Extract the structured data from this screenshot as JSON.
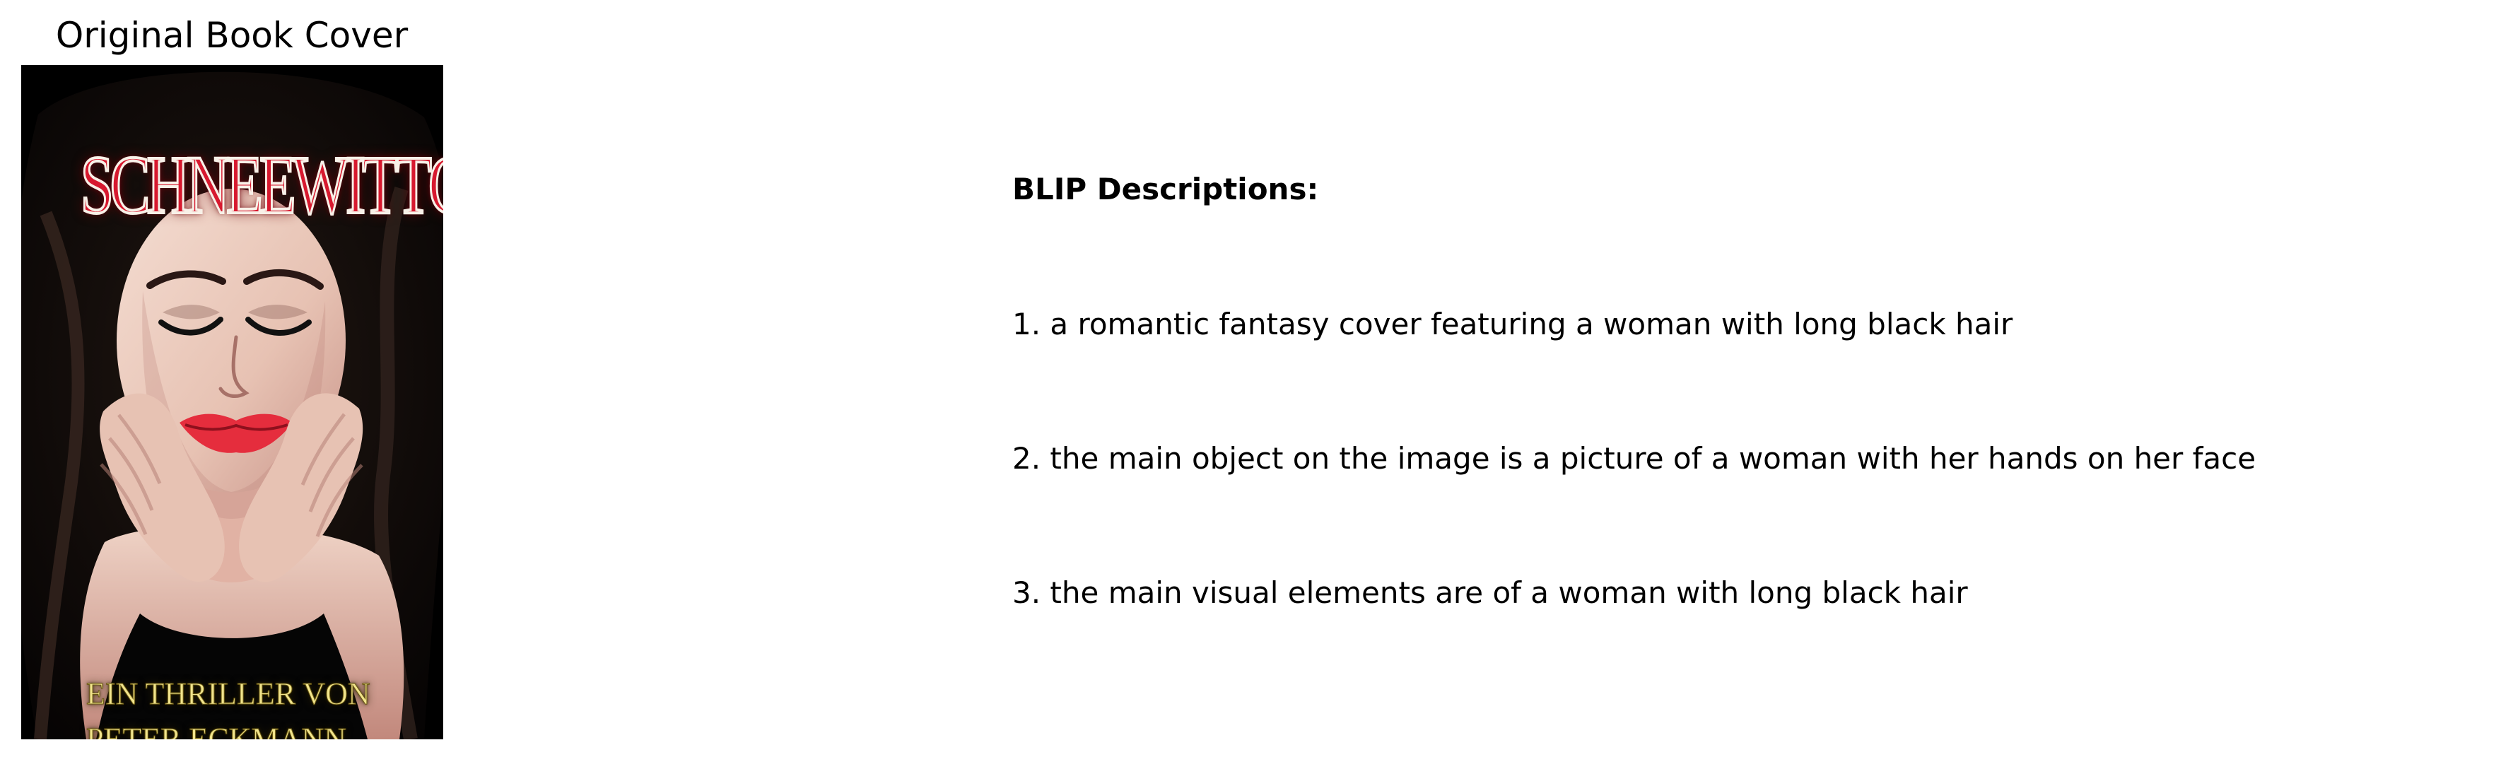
{
  "cover_panel": {
    "title": "Original Book Cover",
    "cover": {
      "headline": "SCHNEEWITTCHEN",
      "byline_line_1": "EIN THRILLER VON",
      "byline_line_2": "PETER ECKMANN"
    }
  },
  "blip": {
    "heading": "BLIP Descriptions:",
    "items": [
      "1. a romantic fantasy cover featuring a woman with long black hair",
      "2. the main object on the image is a picture of a woman with her hands on her face",
      "3. the main visual elements are of a woman with long black hair"
    ]
  },
  "colors": {
    "background": "#ffffff",
    "text": "#000000",
    "cover_background": "#000000",
    "headline_red": "#d7192f",
    "byline_yellow": "#f2e58d",
    "lip_red": "#e52d3d"
  }
}
